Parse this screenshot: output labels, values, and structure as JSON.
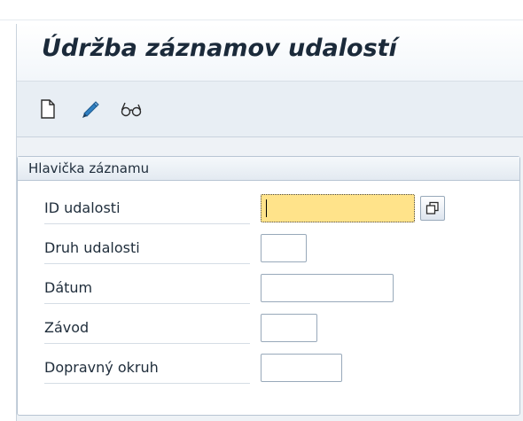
{
  "screen": {
    "title": "Údržba záznamov udalostí"
  },
  "toolbar": {
    "buttons": [
      {
        "icon": "new-document-icon"
      },
      {
        "icon": "pencil-edit-icon"
      },
      {
        "icon": "glasses-display-icon"
      }
    ]
  },
  "group": {
    "title": "Hlavička záznamu"
  },
  "fields": {
    "id_udalosti": {
      "label": "ID udalosti",
      "value": ""
    },
    "druh_udalosti": {
      "label": "Druh udalosti",
      "value": ""
    },
    "datum": {
      "label": "Dátum",
      "value": ""
    },
    "zavod": {
      "label": "Závod",
      "value": ""
    },
    "dopravny_okruh": {
      "label": "Dopravný okruh",
      "value": ""
    }
  },
  "colors": {
    "focused_input": "#ffe38a",
    "background": "#eef2f6",
    "edit_icon": "#2f7fc2"
  }
}
